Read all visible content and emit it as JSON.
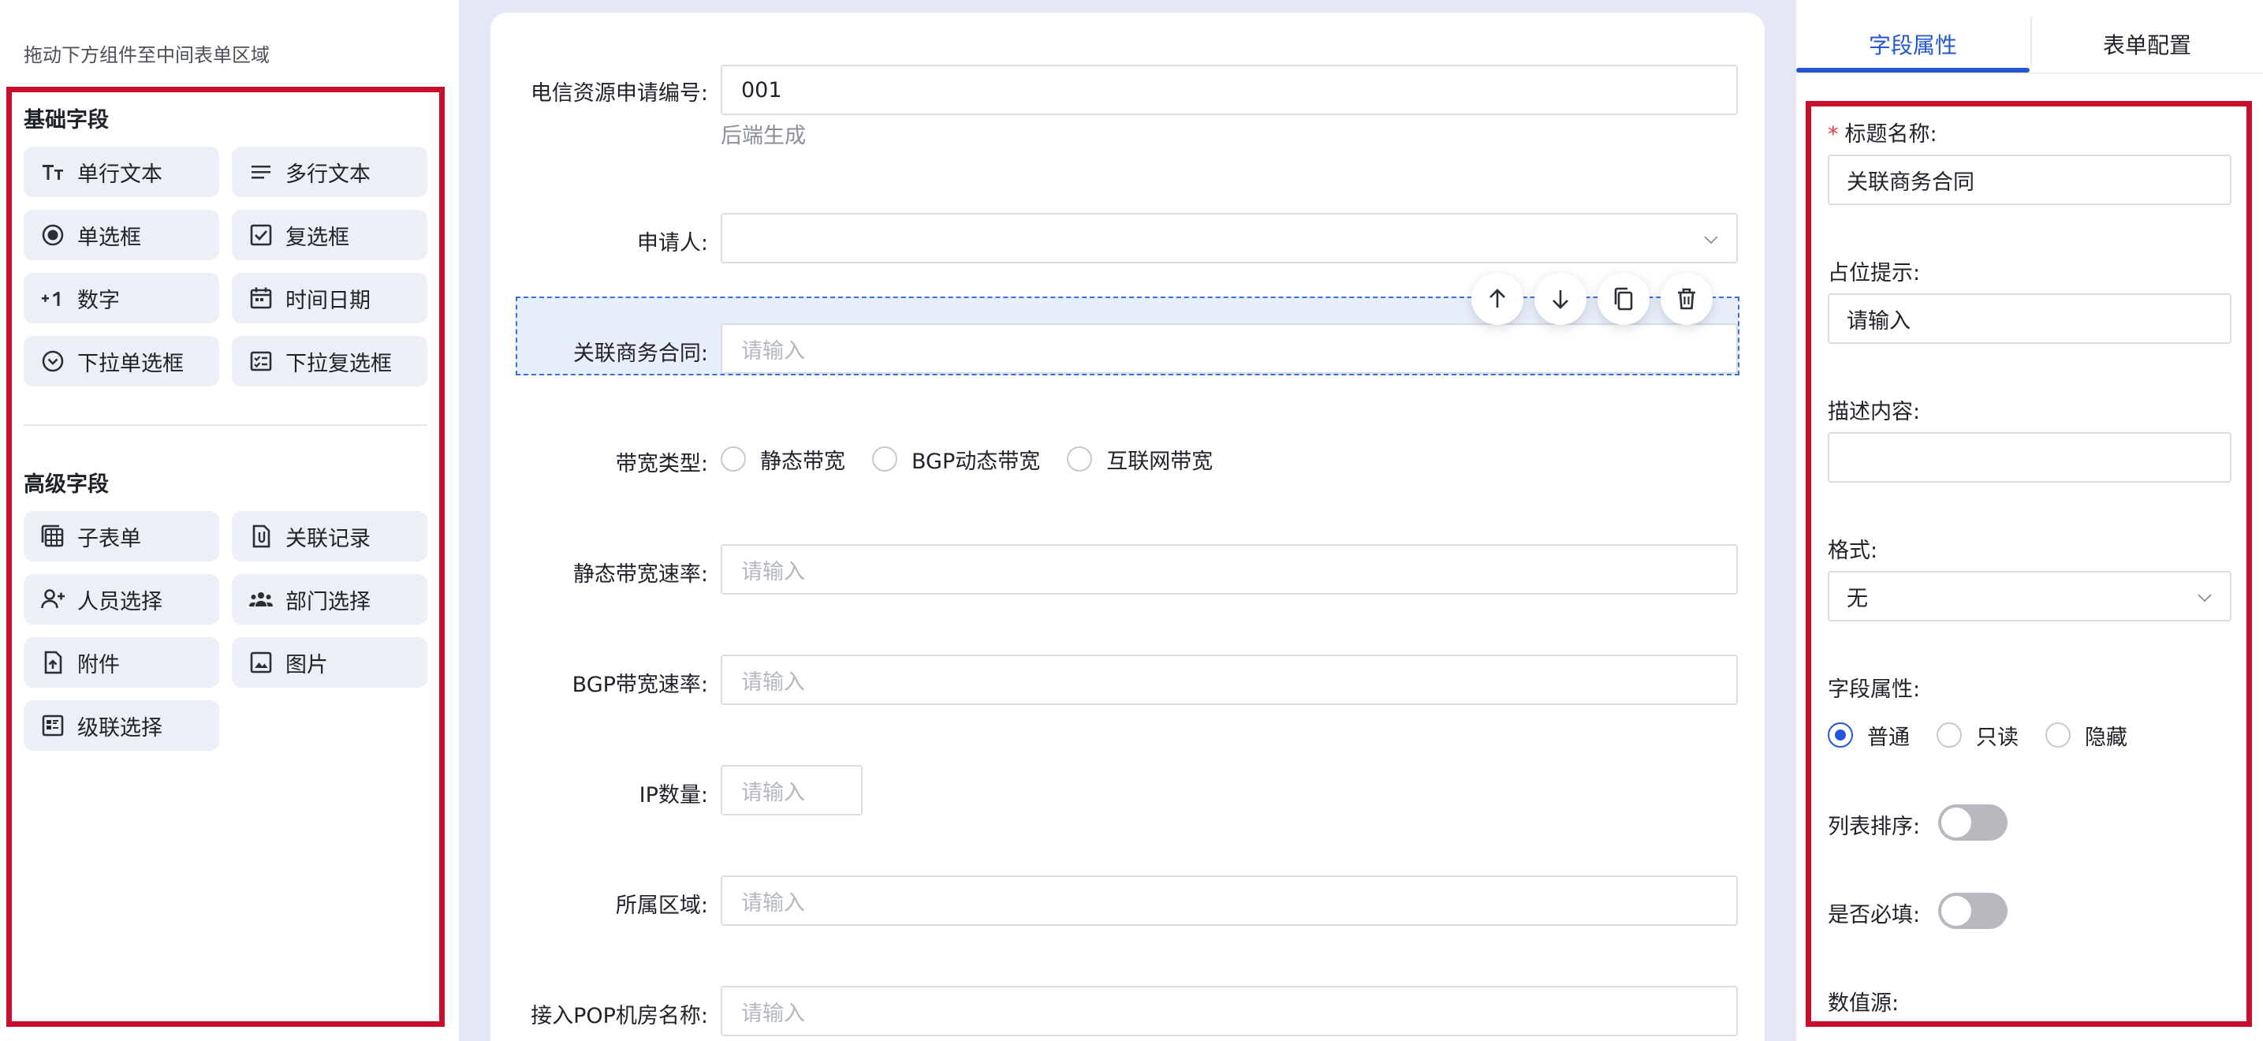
{
  "left_panel": {
    "hint": "拖动下方组件至中间表单区域",
    "basic_section_title": "基础字段",
    "basic_items": [
      {
        "label": "单行文本",
        "icon": "text-size-icon"
      },
      {
        "label": "多行文本",
        "icon": "lines-icon"
      },
      {
        "label": "单选框",
        "icon": "radio-icon"
      },
      {
        "label": "复选框",
        "icon": "checkbox-icon"
      },
      {
        "label": "数字",
        "icon": "plus-one-icon"
      },
      {
        "label": "时间日期",
        "icon": "calendar-icon"
      },
      {
        "label": "下拉单选框",
        "icon": "dropdown-icon"
      },
      {
        "label": "下拉复选框",
        "icon": "dropdown-checklist-icon"
      }
    ],
    "advanced_section_title": "高级字段",
    "advanced_items": [
      {
        "label": "子表单",
        "icon": "subform-icon"
      },
      {
        "label": "关联记录",
        "icon": "linked-record-icon"
      },
      {
        "label": "人员选择",
        "icon": "add-person-icon"
      },
      {
        "label": "部门选择",
        "icon": "group-icon"
      },
      {
        "label": "附件",
        "icon": "upload-file-icon"
      },
      {
        "label": "图片",
        "icon": "image-icon"
      },
      {
        "label": "级联选择",
        "icon": "cascade-icon"
      }
    ]
  },
  "form": {
    "fields": {
      "app_no": {
        "label": "电信资源申请编号:",
        "value": "001",
        "helper": "后端生成"
      },
      "applicant": {
        "label": "申请人:",
        "value": ""
      },
      "contract": {
        "label": "关联商务合同:",
        "placeholder": "请输入"
      },
      "bandwidth_type": {
        "label": "带宽类型:",
        "options": [
          "静态带宽",
          "BGP动态带宽",
          "互联网带宽"
        ]
      },
      "static_rate": {
        "label": "静态带宽速率:",
        "placeholder": "请输入"
      },
      "bgp_rate": {
        "label": "BGP带宽速率:",
        "placeholder": "请输入"
      },
      "ip_count": {
        "label": "IP数量:",
        "placeholder": "请输入"
      },
      "region": {
        "label": "所属区域:",
        "placeholder": "请输入"
      },
      "pop_room": {
        "label": "接入POP机房名称:",
        "placeholder": "请输入"
      }
    },
    "toolbar_icons": [
      "arrow-up-icon",
      "arrow-down-icon",
      "copy-icon",
      "delete-icon"
    ]
  },
  "right_panel": {
    "tabs": [
      "字段属性",
      "表单配置"
    ],
    "active_tab": "字段属性",
    "title_label": "标题名称:",
    "title_value": "关联商务合同",
    "placeholder_label": "占位提示:",
    "placeholder_value": "请输入",
    "description_label": "描述内容:",
    "description_value": "",
    "format_label": "格式:",
    "format_value": "无",
    "field_attr_label": "字段属性:",
    "field_attr_options": [
      "普通",
      "只读",
      "隐藏"
    ],
    "field_attr_selected": "普通",
    "list_sort_label": "列表排序:",
    "list_sort_on": false,
    "required_label": "是否必填:",
    "required_on": false,
    "data_source_label": "数值源:"
  },
  "colors": {
    "accent": "#2456d6",
    "highlight_box": "#c8102e",
    "selected_dashed": "#3b6fe0",
    "canvas_bg": "#e4e8f6",
    "component_bg": "#eceff6"
  }
}
